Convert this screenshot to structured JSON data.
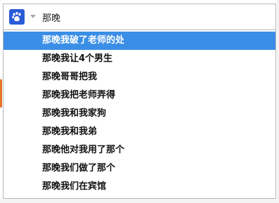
{
  "search": {
    "query": "那晚",
    "logo_icon": "baidu-paw-icon",
    "dropdown_icon": "chevron-down-icon"
  },
  "suggestions": [
    {
      "text": "那晚我破了老师的处",
      "active": true
    },
    {
      "text": "那晚我让4个男生",
      "active": false
    },
    {
      "text": "那晚哥哥把我",
      "active": false
    },
    {
      "text": "那晚我把老师弄得",
      "active": false
    },
    {
      "text": "那晚我和我家狗",
      "active": false
    },
    {
      "text": "那晚我和我弟",
      "active": false
    },
    {
      "text": "那晚他对我用了那个",
      "active": false
    },
    {
      "text": "那晚我们做了那个",
      "active": false
    },
    {
      "text": "那晚我们在宾馆",
      "active": false
    }
  ],
  "colors": {
    "accent": "#3a8ee6",
    "logo": "#2a5bd7"
  }
}
